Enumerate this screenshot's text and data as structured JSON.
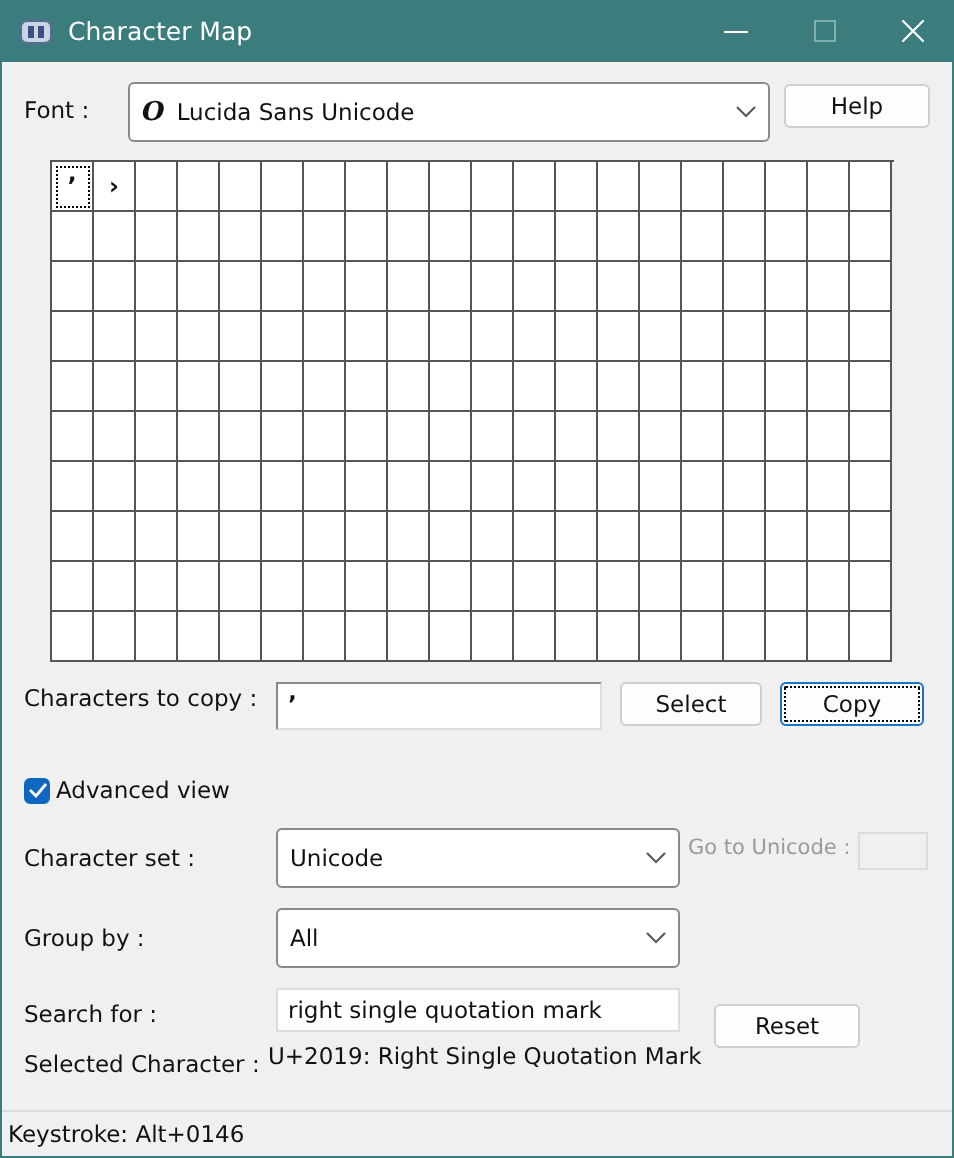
{
  "window": {
    "title": "Character Map"
  },
  "font": {
    "label": "Font :",
    "value": "Lucida Sans Unicode",
    "glyph": "O"
  },
  "help_button": "Help",
  "grid": {
    "cells": [
      {
        "char": "’",
        "selected": true
      },
      {
        "char": "›",
        "selected": false
      }
    ]
  },
  "copy": {
    "label": "Characters to copy :",
    "value": "’",
    "select_button": "Select",
    "copy_button": "Copy"
  },
  "advanced_view": {
    "label": "Advanced view",
    "checked": true
  },
  "character_set": {
    "label": "Character set :",
    "value": "Unicode"
  },
  "go_to_unicode": {
    "label": "Go to Unicode :",
    "disabled": true
  },
  "group_by": {
    "label": "Group by :",
    "value": "All"
  },
  "search": {
    "label": "Search for :",
    "value": "right single quotation mark",
    "reset_button": "Reset"
  },
  "selected_character": {
    "label": "Selected Character :",
    "value": "U+2019: Right Single Quotation Mark"
  },
  "status_bar": "Keystroke: Alt+0146"
}
